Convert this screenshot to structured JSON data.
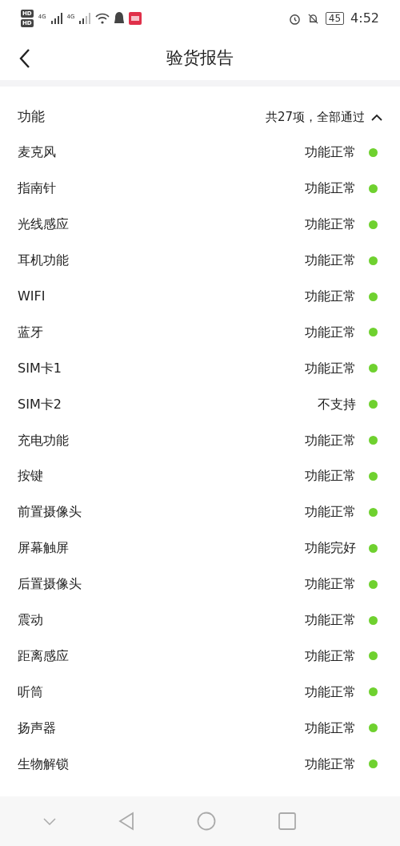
{
  "status_bar": {
    "hd_1": "HD",
    "hd_2": "HD",
    "net_1": "4G",
    "net_2": "4G",
    "battery": "45",
    "time": "4:52"
  },
  "header": {
    "title": "验货报告"
  },
  "section": {
    "title": "功能",
    "summary": "共27项，全部通过",
    "expanded": true
  },
  "items": [
    {
      "name": "麦克风",
      "result": "功能正常",
      "color": "#6fd12f"
    },
    {
      "name": "指南针",
      "result": "功能正常",
      "color": "#6fd12f"
    },
    {
      "name": "光线感应",
      "result": "功能正常",
      "color": "#6fd12f"
    },
    {
      "name": "耳机功能",
      "result": "功能正常",
      "color": "#6fd12f"
    },
    {
      "name": "WIFI",
      "result": "功能正常",
      "color": "#6fd12f"
    },
    {
      "name": "蓝牙",
      "result": "功能正常",
      "color": "#6fd12f"
    },
    {
      "name": "SIM卡1",
      "result": "功能正常",
      "color": "#6fd12f"
    },
    {
      "name": "SIM卡2",
      "result": "不支持",
      "color": "#6fd12f"
    },
    {
      "name": "充电功能",
      "result": "功能正常",
      "color": "#6fd12f"
    },
    {
      "name": "按键",
      "result": "功能正常",
      "color": "#6fd12f"
    },
    {
      "name": "前置摄像头",
      "result": "功能正常",
      "color": "#6fd12f"
    },
    {
      "name": "屏幕触屏",
      "result": "功能完好",
      "color": "#6fd12f"
    },
    {
      "name": "后置摄像头",
      "result": "功能正常",
      "color": "#6fd12f"
    },
    {
      "name": "震动",
      "result": "功能正常",
      "color": "#6fd12f"
    },
    {
      "name": "距离感应",
      "result": "功能正常",
      "color": "#6fd12f"
    },
    {
      "name": "听筒",
      "result": "功能正常",
      "color": "#6fd12f"
    },
    {
      "name": "扬声器",
      "result": "功能正常",
      "color": "#6fd12f"
    },
    {
      "name": "生物解锁",
      "result": "功能正常",
      "color": "#6fd12f"
    }
  ]
}
